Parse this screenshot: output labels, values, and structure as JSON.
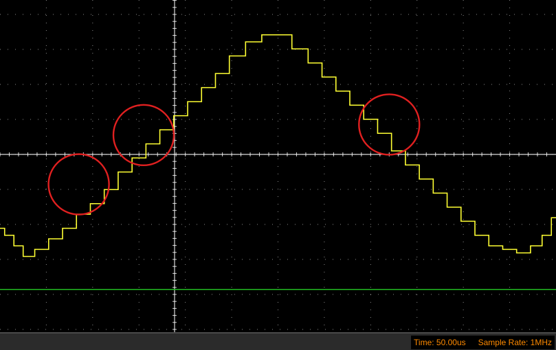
{
  "status_bar": {
    "time_label": "Time: 50.00us",
    "sample_rate_label": "Sample Rate: 1MHz"
  },
  "colors": {
    "background": "#000000",
    "grid": "#ffffff",
    "trace_signal": "#ffff33",
    "trace_reference": "#22bb22",
    "markers": "#e02020",
    "readout_text": "#ff8a00"
  },
  "chart_data": {
    "type": "line",
    "title": "",
    "xlabel": "",
    "ylabel": "",
    "grid": true,
    "x_divisions": 12,
    "y_divisions": 8,
    "xlim": [
      0,
      12
    ],
    "ylim": [
      -4,
      4
    ],
    "series": [
      {
        "x": [
          0.0,
          0.2,
          0.4,
          0.6,
          0.9,
          1.2,
          1.5,
          1.8,
          2.1,
          2.4,
          2.7,
          3.0,
          3.3,
          3.6,
          3.9,
          4.2,
          4.5,
          4.8,
          5.1,
          5.5,
          5.8,
          6.1,
          6.5,
          6.8,
          7.1,
          7.4,
          7.7,
          8.0,
          8.3,
          8.6,
          8.9,
          9.2,
          9.5,
          9.8,
          10.1,
          10.4,
          10.7,
          11.0,
          11.3,
          11.6,
          11.8,
          12.0
        ],
        "y": [
          -2.1,
          -2.3,
          -2.6,
          -2.9,
          -2.7,
          -2.4,
          -2.1,
          -1.7,
          -1.4,
          -1.0,
          -0.5,
          -0.1,
          0.3,
          0.7,
          1.1,
          1.5,
          1.9,
          2.3,
          2.8,
          3.2,
          3.4,
          3.4,
          3.0,
          2.6,
          2.2,
          1.8,
          1.4,
          1.0,
          0.6,
          0.1,
          -0.3,
          -0.7,
          -1.1,
          -1.5,
          -1.9,
          -2.3,
          -2.6,
          -2.7,
          -2.8,
          -2.6,
          -2.3,
          -1.8
        ]
      },
      {
        "x": [
          0,
          12
        ],
        "y": [
          -3.0,
          -3.0
        ]
      }
    ],
    "annotations": [
      {
        "shape": "circle",
        "cx": 1.7,
        "cy": -0.85
      },
      {
        "shape": "circle",
        "cx": 3.1,
        "cy": 0.55
      },
      {
        "shape": "circle",
        "cx": 8.4,
        "cy": 0.85
      }
    ]
  }
}
